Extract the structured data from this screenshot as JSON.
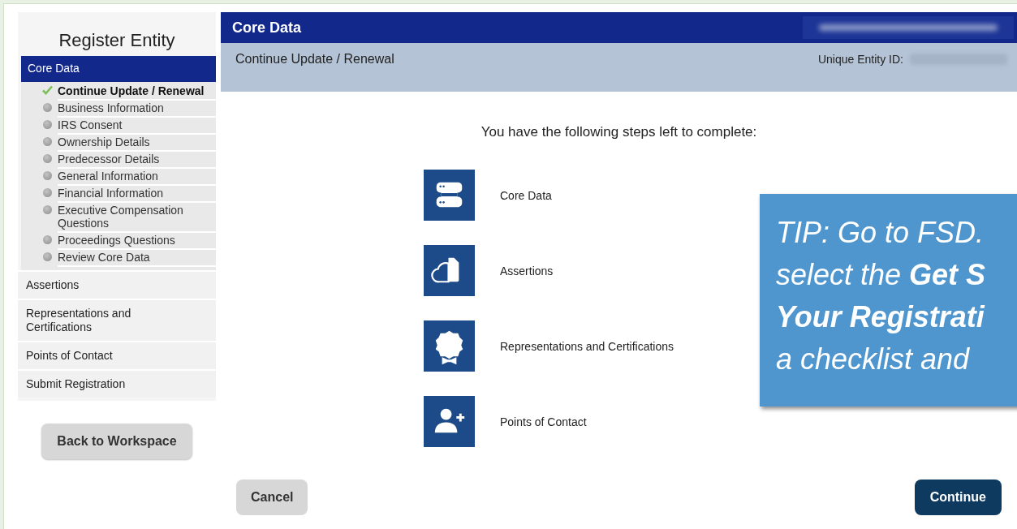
{
  "sidebar": {
    "title": "Register Entity",
    "sections": [
      {
        "label": "Core Data",
        "selected": true,
        "steps": [
          {
            "label": "Continue Update / Renewal",
            "completed": true,
            "selected": true
          },
          {
            "label": "Business Information",
            "completed": false,
            "selected": false
          },
          {
            "label": "IRS Consent",
            "completed": false,
            "selected": false
          },
          {
            "label": "Ownership Details",
            "completed": false,
            "selected": false
          },
          {
            "label": "Predecessor Details",
            "completed": false,
            "selected": false
          },
          {
            "label": "General Information",
            "completed": false,
            "selected": false
          },
          {
            "label": "Financial Information",
            "completed": false,
            "selected": false
          },
          {
            "label": "Executive Compensation Questions",
            "completed": false,
            "selected": false
          },
          {
            "label": "Proceedings Questions",
            "completed": false,
            "selected": false
          },
          {
            "label": "Review Core Data",
            "completed": false,
            "selected": false
          }
        ]
      },
      {
        "label": "Assertions",
        "selected": false
      },
      {
        "label": "Representations and Certifications",
        "selected": false
      },
      {
        "label": "Points of Contact",
        "selected": false
      },
      {
        "label": "Submit Registration",
        "selected": false
      }
    ],
    "back_button": "Back to Workspace"
  },
  "header": {
    "title": "Core Data",
    "subtitle": "Continue Update / Renewal",
    "entity_id_label": "Unique Entity ID:"
  },
  "intro": "You have the following steps left to complete:",
  "steps": [
    {
      "kind": "server",
      "label": "Core Data"
    },
    {
      "kind": "cloud",
      "label": "Assertions"
    },
    {
      "kind": "badge",
      "label": "Representations and Certifications"
    },
    {
      "kind": "user-add",
      "label": "Points of Contact"
    }
  ],
  "buttons": {
    "cancel": "Cancel",
    "continue": "Continue"
  },
  "tip": {
    "lines": [
      {
        "text": "TIP: Go to FSD.",
        "bold": false
      },
      {
        "text": "select the **Get S**",
        "bold": false
      },
      {
        "text": "Your Registrati",
        "bold": true
      },
      {
        "text": "a checklist and",
        "bold": false
      }
    ]
  }
}
